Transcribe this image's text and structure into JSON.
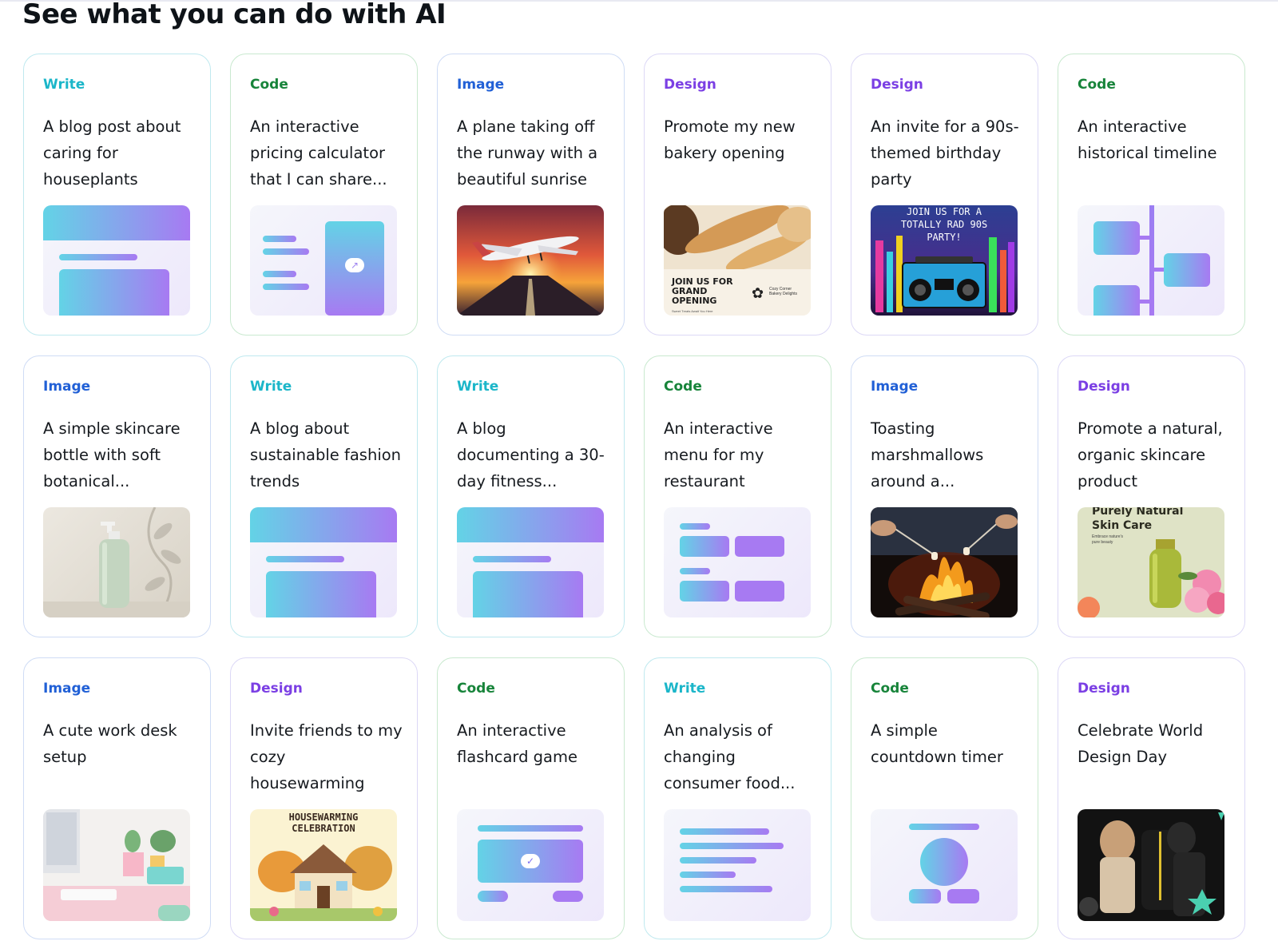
{
  "title": "See what you can do with AI",
  "cards": [
    {
      "category": "Write",
      "text": "A blog post about caring for houseplants",
      "thumb": "doc-layout-icon"
    },
    {
      "category": "Code",
      "text": "An interactive pricing calculator that I can share...",
      "thumb": "calculator-icon"
    },
    {
      "category": "Image",
      "text": "A plane taking off the runway with a beautiful sunrise",
      "thumb": "plane-sunrise-image"
    },
    {
      "category": "Design",
      "text": "Promote my new bakery opening",
      "thumb": "bakery-flyer-image"
    },
    {
      "category": "Design",
      "text": "An invite for a 90s-themed birthday party",
      "thumb": "boombox-invite-image"
    },
    {
      "category": "Code",
      "text": "An interactive historical timeline",
      "thumb": "timeline-icon"
    },
    {
      "category": "Image",
      "text": "A simple skincare bottle with soft botanical...",
      "thumb": "skincare-bottle-image"
    },
    {
      "category": "Write",
      "text": "A blog about sustainable fashion trends",
      "thumb": "doc-layout-icon"
    },
    {
      "category": "Write",
      "text": "A blog documenting a 30-day fitness...",
      "thumb": "doc-layout-icon"
    },
    {
      "category": "Code",
      "text": "An interactive menu for my restaurant",
      "thumb": "menu-icon"
    },
    {
      "category": "Image",
      "text": "Toasting marshmallows around a...",
      "thumb": "campfire-image"
    },
    {
      "category": "Design",
      "text": "Promote a natural, organic skincare product",
      "thumb": "skincare-ad-image"
    },
    {
      "category": "Image",
      "text": "A cute work desk setup",
      "thumb": "work-desk-image"
    },
    {
      "category": "Design",
      "text": "Invite friends to my cozy housewarming",
      "thumb": "housewarming-image"
    },
    {
      "category": "Code",
      "text": "An interactive flashcard game",
      "thumb": "flashcard-icon"
    },
    {
      "category": "Write",
      "text": "An analysis of changing consumer food...",
      "thumb": "text-lines-icon"
    },
    {
      "category": "Code",
      "text": "A simple countdown timer",
      "thumb": "timer-icon"
    },
    {
      "category": "Design",
      "text": "Celebrate World Design Day",
      "thumb": "design-day-image"
    }
  ],
  "thumb_text": {
    "bakery": "JOIN US FOR GRAND OPENING",
    "bakery_brand": "Cozy Corner Bakery Delights",
    "bakery_tag": "Sweet Treats Await You Here",
    "party": "JOIN US FOR A TOTALLY RAD 90S PARTY!",
    "skincare_title": "Purely Natural Skin Care",
    "skincare_tag": "Embrace nature's pure beauty",
    "housewarming": "HOUSEWARMING CELEBRATION"
  },
  "colors": {
    "write": "#1bb6c9",
    "code": "#17843a",
    "image": "#2160d6",
    "design": "#7b3fe4",
    "gradient_start": "#63d3e6",
    "gradient_end": "#a77af2"
  }
}
